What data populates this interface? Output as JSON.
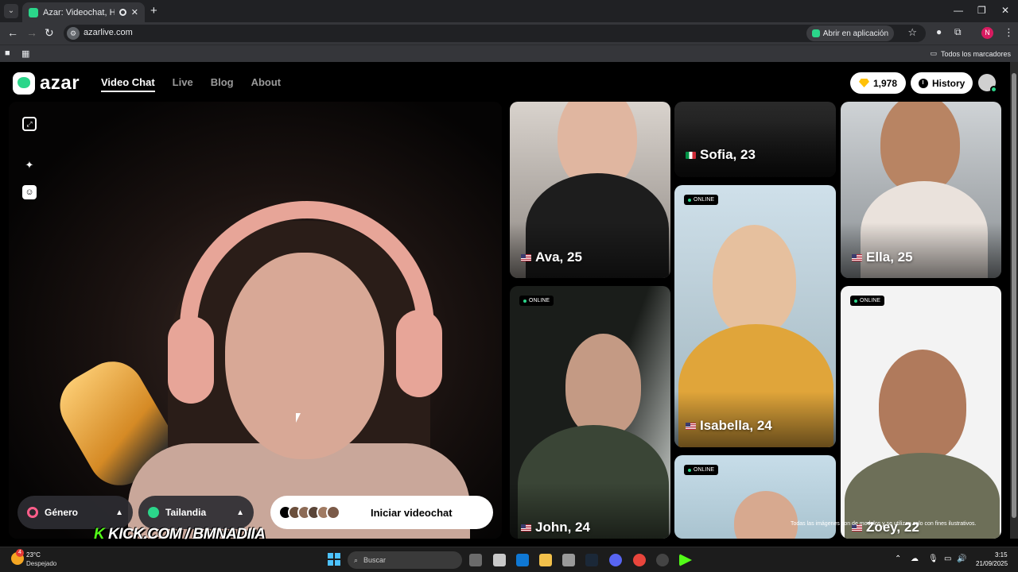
{
  "browser": {
    "tab_title": "Azar: Videochat, Haz nuevo",
    "tab_close": "✕",
    "new_tab": "+",
    "url": "azarlive.com",
    "open_in_app": "Abrir en aplicación",
    "all_bookmarks": "Todos los marcadores",
    "profile_initial": "N",
    "extension_badge": "2"
  },
  "header": {
    "logo": "azar",
    "nav": [
      "Video Chat",
      "Live",
      "Blog",
      "About"
    ],
    "gems": "1,978",
    "history": "History"
  },
  "video_panel": {
    "gender_label": "Género",
    "country_label": "Tailandia",
    "start_label": "Iniciar videochat"
  },
  "cards": [
    {
      "name": "Ava, 25",
      "flag": "us"
    },
    {
      "name": "Sofia, 23",
      "flag": "it"
    },
    {
      "name": "Ella, 25",
      "flag": "us"
    },
    {
      "name": "Isabella, 24",
      "flag": "us",
      "badge": "ONLINE"
    },
    {
      "name": "John, 24",
      "flag": "us",
      "badge": "ONLINE"
    },
    {
      "name": "Zoey, 22",
      "flag": "us",
      "badge": "ONLINE"
    },
    {
      "name": "",
      "badge": "ONLINE"
    }
  ],
  "disclaimer": "Todas las imágenes son de modelos y se utilizan solo con fines ilustrativos.",
  "overlay": {
    "k": "K",
    "text": "KICK.COM / BMNADIIA"
  },
  "taskbar": {
    "temperature": "23°C",
    "condition": "Despejado",
    "weather_badge": "4",
    "search_placeholder": "Buscar",
    "time": "3:15",
    "date": "21/09/2025"
  },
  "colors": {
    "brand": "#2bd68a",
    "gem": "#ffc107",
    "kick": "#53fc18"
  }
}
